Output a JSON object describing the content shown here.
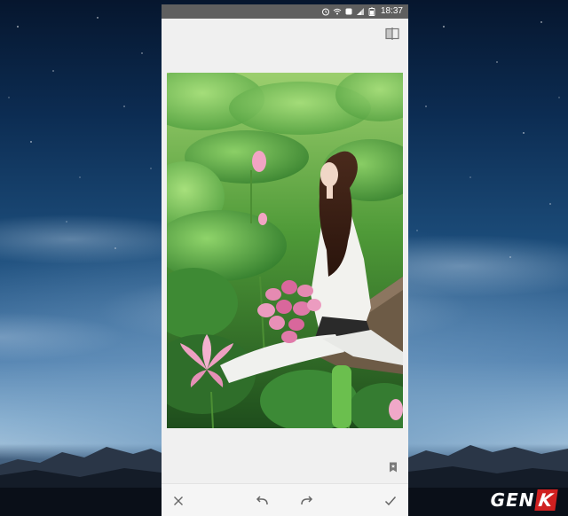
{
  "status_bar": {
    "time": "18:37"
  },
  "editor": {
    "compare_icon": "compare-split-icon",
    "bookmark_icon": "bookmark-star-icon"
  },
  "toolbar": {
    "cancel_icon": "close-icon",
    "undo_icon": "undo-icon",
    "redo_icon": "redo-icon",
    "apply_icon": "checkmark-icon"
  },
  "watermark": {
    "brand": "GENK"
  },
  "colors": {
    "status_bar": "#5f5f5f",
    "editor_bg": "#f0f0f0",
    "logo_accent": "#d02020"
  }
}
